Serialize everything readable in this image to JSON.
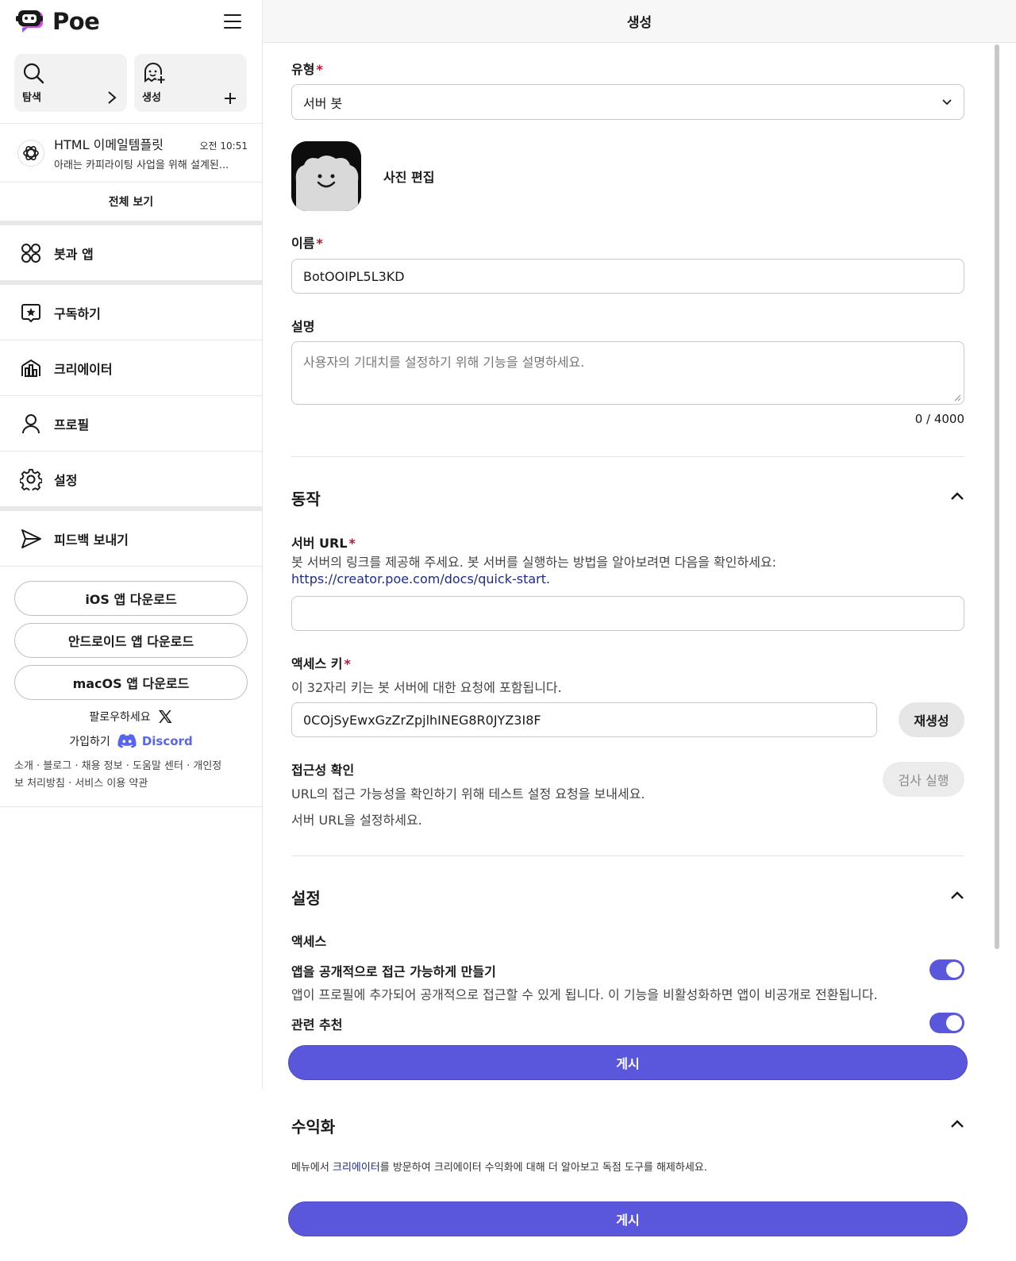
{
  "app": {
    "name": "Poe"
  },
  "sidebar": {
    "explore_label": "탐색",
    "create_label": "생성",
    "recent_chat": {
      "title": "HTML 이메일템플릿",
      "time": "오전 10:51",
      "preview": "아래는 카피라이팅 사업을 위해 설계된..."
    },
    "see_all": "전체 보기",
    "nav": {
      "bots_apps": "봇과 앱",
      "subscribe": "구독하기",
      "creator": "크리에이터",
      "profile": "프로필",
      "settings": "설정",
      "feedback": "피드백 보내기"
    },
    "downloads": {
      "ios": "iOS 앱 다운로드",
      "android": "안드로이드 앱 다운로드",
      "macos": "macOS 앱 다운로드"
    },
    "follow_label": "팔로우하세요",
    "join_label": "가입하기",
    "discord_label": "Discord",
    "footer": {
      "about": "소개",
      "blog": "블로그",
      "careers": "채용 정보",
      "help": "도움말 센터",
      "privacy_1": "개인정",
      "privacy_2": "보 처리방침",
      "terms": "서비스 이용 약관",
      "sep": " · "
    }
  },
  "page": {
    "title": "생성"
  },
  "form": {
    "type": {
      "label": "유형",
      "value": "서버 봇"
    },
    "photo": {
      "edit_label": "사진 편집"
    },
    "name": {
      "label": "이름",
      "value": "BotOOIPL5L3KD"
    },
    "description": {
      "label": "설명",
      "placeholder": "사용자의 기대치를 설정하기 위해 기능을 설명하세요.",
      "counter": "0 / 4000"
    },
    "required_mark": "*"
  },
  "behavior": {
    "title": "동작",
    "server_url": {
      "label": "서버 URL",
      "help": "봇 서버의 링크를 제공해 주세요. 봇 서버를 실행하는 방법을 알아보려면 다음을 확인하세요:",
      "link": "https://creator.poe.com/docs/quick-start",
      "link_suffix": ".",
      "value": ""
    },
    "access_key": {
      "label": "액세스 키",
      "help": "이 32자리 키는 봇 서버에 대한 요청에 포함됩니다.",
      "value": "0COjSyEwxGzZrZpjlhINEG8R0JYZ3I8F",
      "regenerate": "재생성"
    },
    "reachability": {
      "label": "접근성 확인",
      "help": "URL의 접근 가능성을 확인하기 위해 테스트 설정 요청을 보내세요.",
      "status": "서버 URL을 설정하세요.",
      "run_check": "검사 실행"
    }
  },
  "settings_section": {
    "title": "설정",
    "access_label": "액세스",
    "public_title": "앱을 공개적으로 접근 가능하게 만들기",
    "public_help": "앱이 프로필에 추가되어 공개적으로 접근할 수 있게 됩니다. 이 기능을 비활성화하면 앱이 비공개로 전환됩니다.",
    "public_enabled": true,
    "related_label": "관련 추천",
    "related_enabled": true
  },
  "publish_label": "게시",
  "monetization": {
    "title": "수익화",
    "text_before": "메뉴에서 ",
    "link": "크리에이터",
    "text_after": "를 방문하여 크리에이터 수익화에 대해 더 알아보고 독점 도구를 해제하세요."
  },
  "colors": {
    "accent": "#5b57dd",
    "required": "#c8102e",
    "link": "#1d2a8f",
    "discord": "#5865F2"
  }
}
